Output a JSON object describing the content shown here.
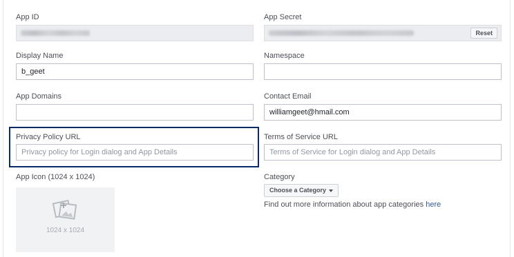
{
  "app_id": {
    "label": "App ID"
  },
  "app_secret": {
    "label": "App Secret",
    "reset_label": "Reset"
  },
  "display_name": {
    "label": "Display Name",
    "value": "b_geet"
  },
  "namespace": {
    "label": "Namespace",
    "value": ""
  },
  "app_domains": {
    "label": "App Domains",
    "value": ""
  },
  "contact_email": {
    "label": "Contact Email",
    "value": "williamgeet@hmail.com"
  },
  "privacy_policy": {
    "label": "Privacy Policy URL",
    "placeholder": "Privacy policy for Login dialog and App Details"
  },
  "terms_of_service": {
    "label": "Terms of Service URL",
    "placeholder": "Terms of Service for Login dialog and App Details"
  },
  "app_icon": {
    "label": "App Icon (1024 x 1024)",
    "size_text": "1024 x 1024",
    "icon": "image-upload-icon"
  },
  "category": {
    "label": "Category",
    "button_label": "Choose a Category",
    "help_text": "Find out more information about app categories ",
    "help_link": "here"
  },
  "colors": {
    "highlight": "#0a2a66",
    "link": "#365899"
  }
}
